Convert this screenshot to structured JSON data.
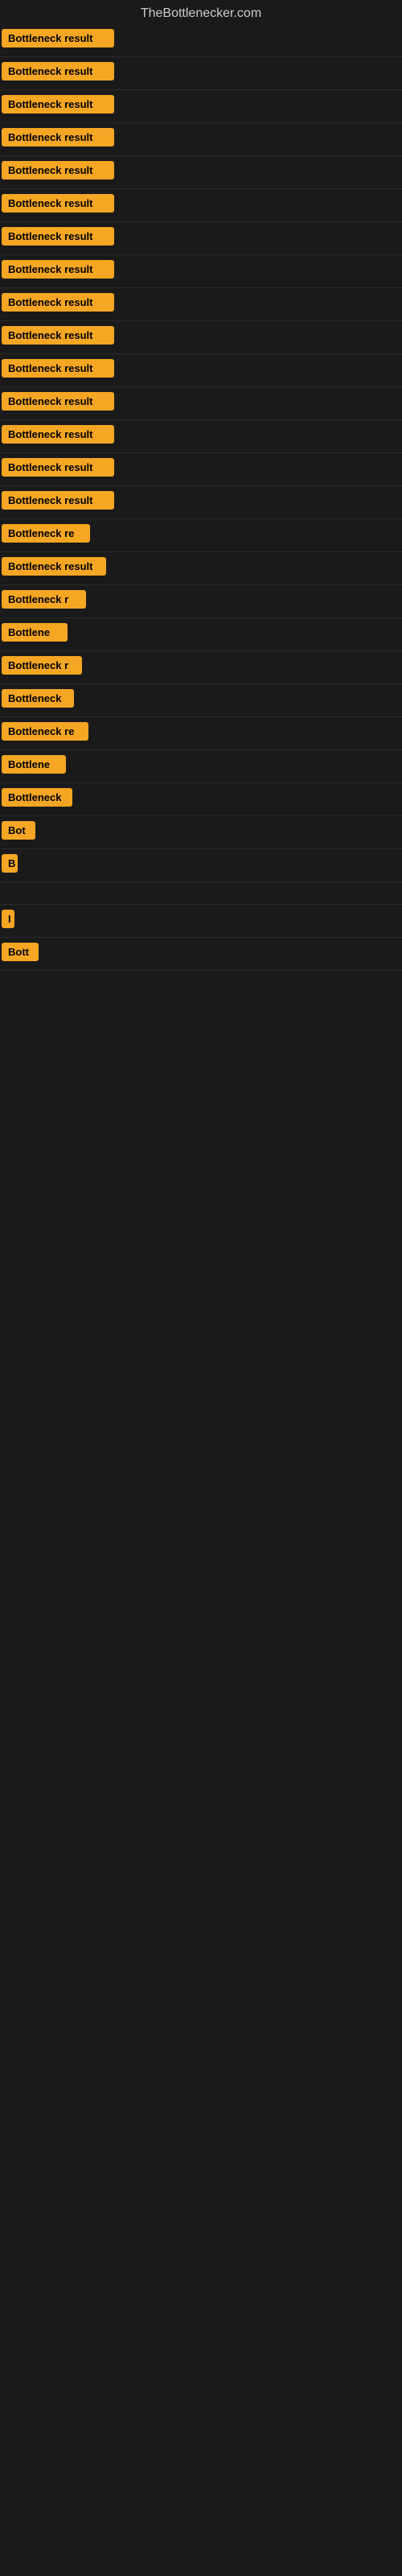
{
  "site": {
    "title": "TheBottlenecker.com"
  },
  "rows": [
    {
      "id": 1,
      "label": "Bottleneck result",
      "width": 140
    },
    {
      "id": 2,
      "label": "Bottleneck result",
      "width": 140
    },
    {
      "id": 3,
      "label": "Bottleneck result",
      "width": 140
    },
    {
      "id": 4,
      "label": "Bottleneck result",
      "width": 140
    },
    {
      "id": 5,
      "label": "Bottleneck result",
      "width": 140
    },
    {
      "id": 6,
      "label": "Bottleneck result",
      "width": 140
    },
    {
      "id": 7,
      "label": "Bottleneck result",
      "width": 140
    },
    {
      "id": 8,
      "label": "Bottleneck result",
      "width": 140
    },
    {
      "id": 9,
      "label": "Bottleneck result",
      "width": 140
    },
    {
      "id": 10,
      "label": "Bottleneck result",
      "width": 140
    },
    {
      "id": 11,
      "label": "Bottleneck result",
      "width": 140
    },
    {
      "id": 12,
      "label": "Bottleneck result",
      "width": 140
    },
    {
      "id": 13,
      "label": "Bottleneck result",
      "width": 140
    },
    {
      "id": 14,
      "label": "Bottleneck result",
      "width": 140
    },
    {
      "id": 15,
      "label": "Bottleneck result",
      "width": 140
    },
    {
      "id": 16,
      "label": "Bottleneck re",
      "width": 110
    },
    {
      "id": 17,
      "label": "Bottleneck result",
      "width": 130
    },
    {
      "id": 18,
      "label": "Bottleneck r",
      "width": 105
    },
    {
      "id": 19,
      "label": "Bottlene",
      "width": 82
    },
    {
      "id": 20,
      "label": "Bottleneck r",
      "width": 100
    },
    {
      "id": 21,
      "label": "Bottleneck",
      "width": 90
    },
    {
      "id": 22,
      "label": "Bottleneck re",
      "width": 108
    },
    {
      "id": 23,
      "label": "Bottlene",
      "width": 80
    },
    {
      "id": 24,
      "label": "Bottleneck",
      "width": 88
    },
    {
      "id": 25,
      "label": "Bot",
      "width": 42
    },
    {
      "id": 26,
      "label": "B",
      "width": 20
    },
    {
      "id": 27,
      "label": "",
      "width": 0
    },
    {
      "id": 28,
      "label": "I",
      "width": 12
    },
    {
      "id": 29,
      "label": "Bott",
      "width": 46
    }
  ],
  "colors": {
    "badge_bg": "#f5a623",
    "badge_text": "#000000",
    "site_title": "#cccccc",
    "background": "#1a1a1a"
  }
}
